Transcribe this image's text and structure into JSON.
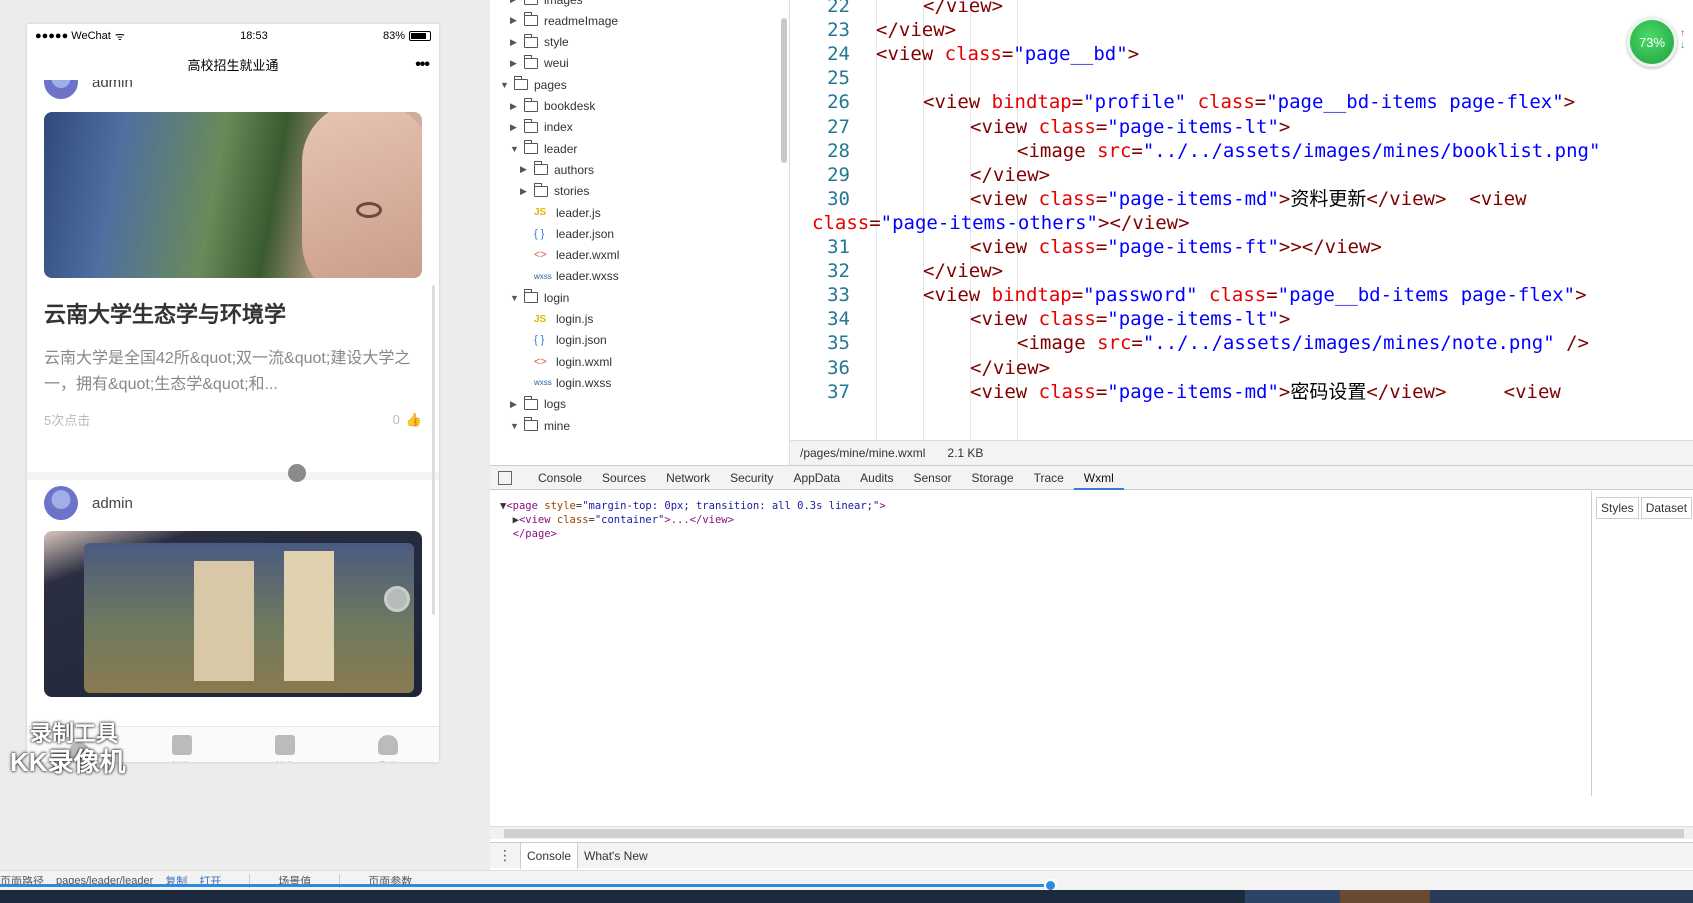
{
  "simulator": {
    "status": {
      "carrier": "●●●●● WeChat",
      "wifi": "ᯤ",
      "time": "18:53",
      "battery": "83%",
      "battery_level": 0.83
    },
    "nav_title": "高校招生就业通",
    "nav_more": "•••",
    "cards": [
      {
        "author": "admin",
        "title": "云南大学生态学与环境学",
        "desc": "云南大学是全国42所&quot;双一流&quot;建设大学之一，拥有&quot;生态学&quot;和...",
        "clicks": "5次点击",
        "likes": "0"
      },
      {
        "author": "admin"
      }
    ],
    "tabs": [
      {
        "label": ""
      },
      {
        "label": "招生"
      },
      {
        "label": "就业"
      },
      {
        "label": "我的"
      }
    ],
    "watermark": {
      "line1": "录制工具",
      "line2": "KK录像机"
    }
  },
  "tree": [
    {
      "label": "images",
      "type": "folder",
      "expanded": false,
      "depth": 1
    },
    {
      "label": "readmeImage",
      "type": "folder",
      "expanded": false,
      "depth": 1
    },
    {
      "label": "style",
      "type": "folder",
      "expanded": false,
      "depth": 1
    },
    {
      "label": "weui",
      "type": "folder",
      "expanded": false,
      "depth": 1
    },
    {
      "label": "pages",
      "type": "folder",
      "expanded": true,
      "depth": 0
    },
    {
      "label": "bookdesk",
      "type": "folder",
      "expanded": false,
      "depth": 1
    },
    {
      "label": "index",
      "type": "folder",
      "expanded": false,
      "depth": 1
    },
    {
      "label": "leader",
      "type": "folder",
      "expanded": true,
      "depth": 1
    },
    {
      "label": "authors",
      "type": "folder",
      "expanded": false,
      "depth": 2
    },
    {
      "label": "stories",
      "type": "folder",
      "expanded": false,
      "depth": 2
    },
    {
      "label": "leader.js",
      "type": "js",
      "depth": 2
    },
    {
      "label": "leader.json",
      "type": "json",
      "depth": 2
    },
    {
      "label": "leader.wxml",
      "type": "wxml",
      "depth": 2
    },
    {
      "label": "leader.wxss",
      "type": "wxss",
      "depth": 2
    },
    {
      "label": "login",
      "type": "folder",
      "expanded": true,
      "depth": 1
    },
    {
      "label": "login.js",
      "type": "js",
      "depth": 2
    },
    {
      "label": "login.json",
      "type": "json",
      "depth": 2
    },
    {
      "label": "login.wxml",
      "type": "wxml",
      "depth": 2
    },
    {
      "label": "login.wxss",
      "type": "wxss",
      "depth": 2
    },
    {
      "label": "logs",
      "type": "folder",
      "expanded": false,
      "depth": 1
    },
    {
      "label": "mine",
      "type": "folder",
      "expanded": true,
      "depth": 1
    }
  ],
  "file_icons": {
    "js": "JS",
    "json": "{ }",
    "wxml": "<>",
    "wxss": "wxss"
  },
  "editor": {
    "lines": [
      {
        "n": "22",
        "indent": 2,
        "parts": [
          [
            "tag",
            "</view>"
          ]
        ]
      },
      {
        "n": "23",
        "indent": 1,
        "parts": [
          [
            "tag",
            "</view>"
          ]
        ]
      },
      {
        "n": "24",
        "indent": 1,
        "parts": [
          [
            "tag",
            "<view "
          ],
          [
            "attr",
            "class"
          ],
          [
            "tag",
            "="
          ],
          [
            "str",
            "\"page__bd\""
          ],
          [
            "tag",
            ">"
          ]
        ]
      },
      {
        "n": "25",
        "indent": 0,
        "parts": []
      },
      {
        "n": "26",
        "indent": 2,
        "parts": [
          [
            "tag",
            "<view "
          ],
          [
            "attr",
            "bindtap"
          ],
          [
            "tag",
            "="
          ],
          [
            "str",
            "\"profile\""
          ],
          [
            "tag",
            " "
          ],
          [
            "attr",
            "class"
          ],
          [
            "tag",
            "="
          ],
          [
            "str",
            "\"page__bd-items page-flex\""
          ],
          [
            "tag",
            ">"
          ]
        ]
      },
      {
        "n": "27",
        "indent": 3,
        "parts": [
          [
            "tag",
            "<view "
          ],
          [
            "attr",
            "class"
          ],
          [
            "tag",
            "="
          ],
          [
            "str",
            "\"page-items-lt\""
          ],
          [
            "tag",
            ">"
          ]
        ]
      },
      {
        "n": "28",
        "indent": 4,
        "parts": [
          [
            "tag",
            "<image "
          ],
          [
            "attr",
            "src"
          ],
          [
            "tag",
            "="
          ],
          [
            "str",
            "\"../../assets/images/mines/booklist.png\""
          ]
        ]
      },
      {
        "n": "29",
        "indent": 3,
        "parts": [
          [
            "tag",
            "</view>"
          ]
        ]
      },
      {
        "n": "30",
        "indent": 3,
        "parts": [
          [
            "tag",
            "<view "
          ],
          [
            "attr",
            "class"
          ],
          [
            "tag",
            "="
          ],
          [
            "str",
            "\"page-items-md\""
          ],
          [
            "tag",
            ">"
          ],
          [
            "txt",
            "资料更新"
          ],
          [
            "tag",
            "</view>  <view"
          ]
        ]
      },
      {
        "n": "",
        "indent": -1,
        "parts": [
          [
            "attr",
            "class"
          ],
          [
            "tag",
            "="
          ],
          [
            "str",
            "\"page-items-others\""
          ],
          [
            "tag",
            "></view>"
          ]
        ]
      },
      {
        "n": "31",
        "indent": 3,
        "parts": [
          [
            "tag",
            "<view "
          ],
          [
            "attr",
            "class"
          ],
          [
            "tag",
            "="
          ],
          [
            "str",
            "\"page-items-ft\""
          ],
          [
            "tag",
            ">></view>"
          ]
        ]
      },
      {
        "n": "32",
        "indent": 2,
        "parts": [
          [
            "tag",
            "</view>"
          ]
        ]
      },
      {
        "n": "33",
        "indent": 2,
        "parts": [
          [
            "tag",
            "<view "
          ],
          [
            "attr",
            "bindtap"
          ],
          [
            "tag",
            "="
          ],
          [
            "str",
            "\"password\""
          ],
          [
            "tag",
            " "
          ],
          [
            "attr",
            "class"
          ],
          [
            "tag",
            "="
          ],
          [
            "str",
            "\"page__bd-items page-flex\""
          ],
          [
            "tag",
            ">"
          ]
        ]
      },
      {
        "n": "34",
        "indent": 3,
        "parts": [
          [
            "tag",
            "<view "
          ],
          [
            "attr",
            "class"
          ],
          [
            "tag",
            "="
          ],
          [
            "str",
            "\"page-items-lt\""
          ],
          [
            "tag",
            ">"
          ]
        ]
      },
      {
        "n": "35",
        "indent": 4,
        "parts": [
          [
            "tag",
            "<image "
          ],
          [
            "attr",
            "src"
          ],
          [
            "tag",
            "="
          ],
          [
            "str",
            "\"../../assets/images/mines/note.png\""
          ],
          [
            "tag",
            " />"
          ]
        ]
      },
      {
        "n": "36",
        "indent": 3,
        "parts": [
          [
            "tag",
            "</view>"
          ]
        ]
      },
      {
        "n": "37",
        "indent": 3,
        "parts": [
          [
            "tag",
            "<view "
          ],
          [
            "attr",
            "class"
          ],
          [
            "tag",
            "="
          ],
          [
            "str",
            "\"page-items-md\""
          ],
          [
            "tag",
            ">"
          ],
          [
            "txt",
            "密码设置"
          ],
          [
            "tag",
            "</view>     <view"
          ]
        ]
      }
    ],
    "file_path": "/pages/mine/mine.wxml",
    "file_size": "2.1 KB",
    "perf_badge": "73%"
  },
  "devtools": {
    "tabs": [
      "Console",
      "Sources",
      "Network",
      "Security",
      "AppData",
      "Audits",
      "Sensor",
      "Storage",
      "Trace",
      "Wxml"
    ],
    "active_tab": "Wxml",
    "dom": {
      "line1_tag": "<page",
      "line1_attr": "style",
      "line1_val": "\"margin-top: 0px; transition: all 0.3s linear;\"",
      "line2_tag": "<view",
      "line2_attr": "class",
      "line2_val": "\"container\"",
      "line2_rest": ">...</view>",
      "line3": "</page>"
    },
    "side_tabs": [
      "Styles",
      "Dataset"
    ],
    "drawer_tabs": [
      "Console",
      "What's New"
    ]
  },
  "bottom_bar": {
    "path_label": "页面路径",
    "path": "pages/leader/leader",
    "copy": "复制",
    "open": "打开",
    "scene": "场景值",
    "params": "页面参数"
  },
  "progress": 0.62
}
